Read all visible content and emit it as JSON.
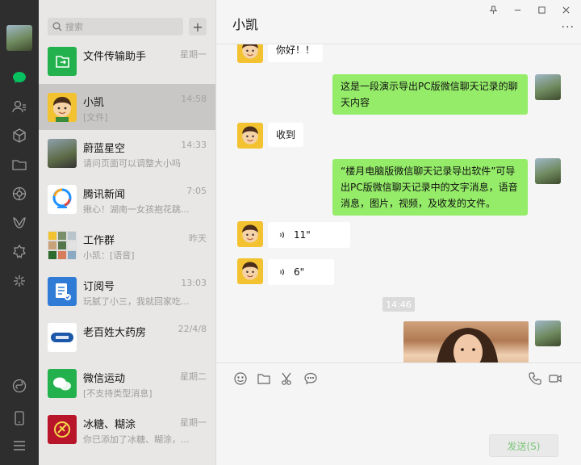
{
  "search": {
    "placeholder": "搜索"
  },
  "chats": [
    {
      "name": "文件传输助手",
      "time": "星期一",
      "preview": ""
    },
    {
      "name": "小凯",
      "time": "14:58",
      "preview": "[文件]"
    },
    {
      "name": "蔚蓝星空",
      "time": "14:33",
      "preview": "请问页面可以调整大小吗"
    },
    {
      "name": "腾讯新闻",
      "time": "7:05",
      "preview": "揪心！湖南一女孩抱花跳..."
    },
    {
      "name": "工作群",
      "time": "昨天",
      "preview": "小凯：[语音]"
    },
    {
      "name": "订阅号",
      "time": "13:03",
      "preview": "玩腻了小三，我就回家吃..."
    },
    {
      "name": "老百姓大药房",
      "time": "22/4/8",
      "preview": ""
    },
    {
      "name": "微信运动",
      "time": "星期二",
      "preview": "[不支持类型消息]"
    },
    {
      "name": "冰糖、糊涂",
      "time": "星期一",
      "preview": "你已添加了冰糖、糊涂，..."
    }
  ],
  "conversation": {
    "title": "小凯",
    "messages": [
      {
        "type": "recv",
        "text": "你好！！"
      },
      {
        "type": "send",
        "text": "这是一段演示导出PC版微信聊天记录的聊天内容"
      },
      {
        "type": "recv",
        "text": "收到"
      },
      {
        "type": "send",
        "text": "“楼月电脑版微信聊天记录导出软件”可导出PC版微信聊天记录中的文字消息，语音消息，图片，视频，及收发的文件。"
      },
      {
        "type": "recv-voice",
        "text": "11\""
      },
      {
        "type": "recv-voice",
        "text": "6\""
      }
    ],
    "timestamp": "14:46"
  },
  "send_label": "发送(S)",
  "colors": {
    "rail": "#2e2e2e",
    "list_bg": "#e9e7e6",
    "bubble_send": "#95ec69",
    "active": "#07c160"
  }
}
